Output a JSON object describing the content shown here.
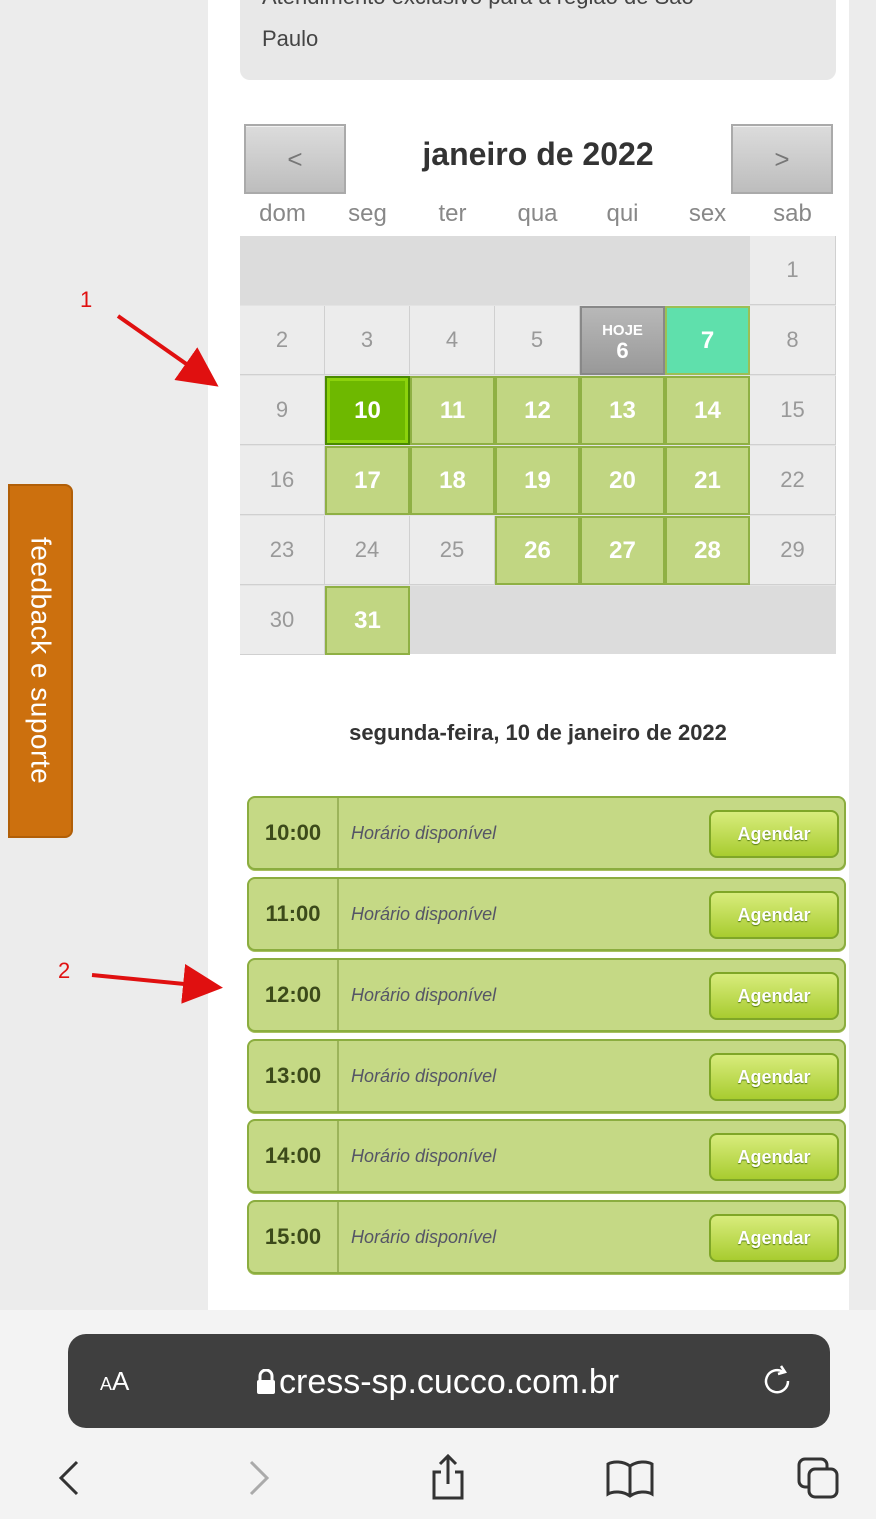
{
  "notice": {
    "clipped_line": "Atendimento exclusivo para a região de São",
    "line2": "Paulo"
  },
  "calendar": {
    "prev_label": "<",
    "next_label": ">",
    "month_title": "janeiro de 2022",
    "weekdays": [
      "dom",
      "seg",
      "ter",
      "qua",
      "qui",
      "sex",
      "sab"
    ],
    "today_label": "HOJE",
    "days": {
      "d1": "1",
      "d2": "2",
      "d3": "3",
      "d4": "4",
      "d5": "5",
      "d6": "6",
      "d7": "7",
      "d8": "8",
      "d9": "9",
      "d10": "10",
      "d11": "11",
      "d12": "12",
      "d13": "13",
      "d14": "14",
      "d15": "15",
      "d16": "16",
      "d17": "17",
      "d18": "18",
      "d19": "19",
      "d20": "20",
      "d21": "21",
      "d22": "22",
      "d23": "23",
      "d24": "24",
      "d25": "25",
      "d26": "26",
      "d27": "27",
      "d28": "28",
      "d29": "29",
      "d30": "30",
      "d31": "31"
    }
  },
  "selected_date_heading": "segunda-feira, 10 de janeiro de 2022",
  "slots": [
    {
      "time": "10:00",
      "status": "Horário disponível",
      "button": "Agendar"
    },
    {
      "time": "11:00",
      "status": "Horário disponível",
      "button": "Agendar"
    },
    {
      "time": "12:00",
      "status": "Horário disponível",
      "button": "Agendar"
    },
    {
      "time": "13:00",
      "status": "Horário disponível",
      "button": "Agendar"
    },
    {
      "time": "14:00",
      "status": "Horário disponível",
      "button": "Agendar"
    },
    {
      "time": "15:00",
      "status": "Horário disponível",
      "button": "Agendar"
    }
  ],
  "feedback_tab": "feedback e suporte",
  "annotations": {
    "one": "1",
    "two": "2",
    "color": "#e01010"
  },
  "browser": {
    "text_size_small": "A",
    "text_size_large": "A",
    "url": "cress-sp.cucco.com.br",
    "icons": [
      "lock-icon",
      "reload-icon",
      "back-icon",
      "forward-icon",
      "share-icon",
      "bookmarks-icon",
      "tabs-icon"
    ]
  },
  "colors": {
    "available": "#c1d682",
    "selected": "#6eb800",
    "today_teal": "#5fe0ac",
    "feedback": "#cc700e"
  }
}
